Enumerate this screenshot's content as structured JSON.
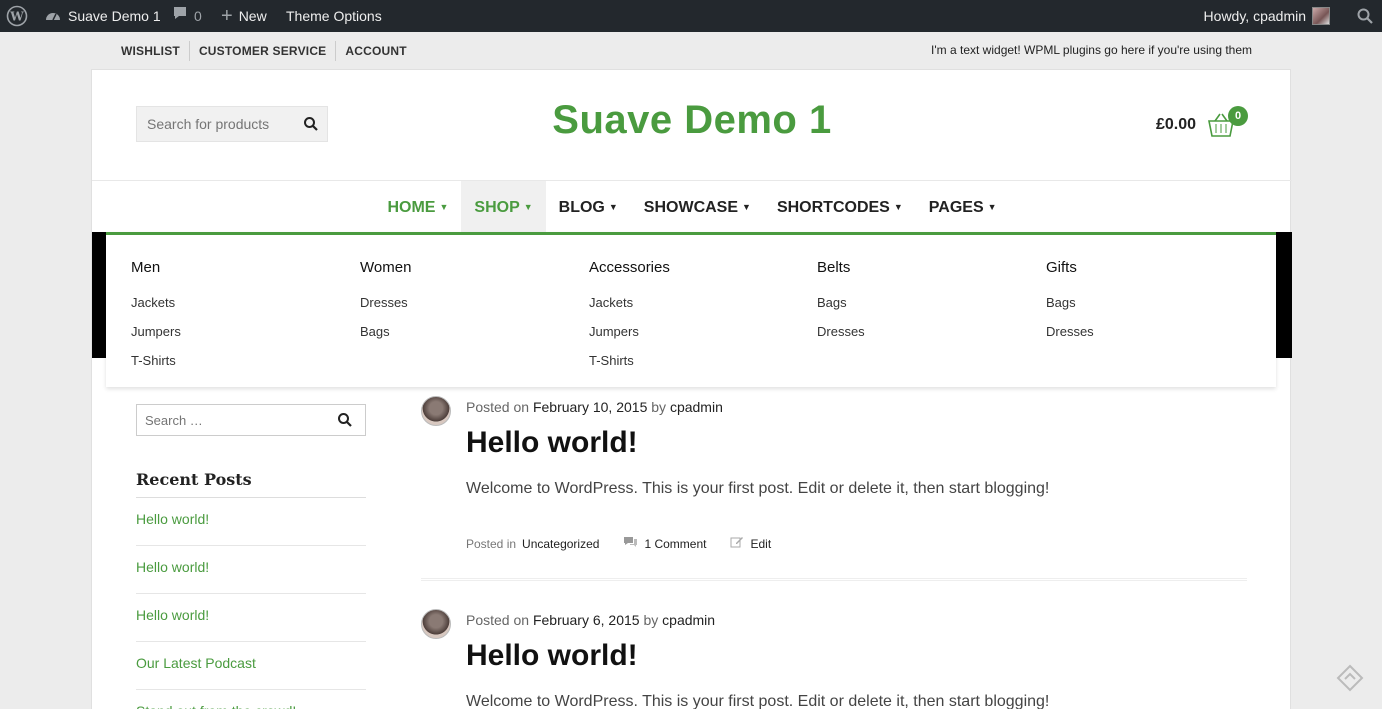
{
  "adminbar": {
    "site_name": "Suave Demo 1",
    "comments_count": "0",
    "new_label": "New",
    "theme_options": "Theme Options",
    "howdy": "Howdy, cpadmin"
  },
  "topbar": {
    "links": [
      "WISHLIST",
      "CUSTOMER SERVICE",
      "ACCOUNT"
    ],
    "widget_text": "I'm a text widget! WPML plugins go here if you're using them"
  },
  "header": {
    "search_placeholder": "Search for products",
    "site_title": "Suave Demo 1",
    "cart_total": "£0.00",
    "cart_count": "0"
  },
  "nav": {
    "items": [
      "HOME",
      "SHOP",
      "BLOG",
      "SHOWCASE",
      "SHORTCODES",
      "PAGES"
    ]
  },
  "mega_menu": {
    "columns": [
      {
        "title": "Men",
        "links": [
          "Jackets",
          "Jumpers",
          "T-Shirts"
        ]
      },
      {
        "title": "Women",
        "links": [
          "Dresses",
          "Bags"
        ]
      },
      {
        "title": "Accessories",
        "links": [
          "Jackets",
          "Jumpers",
          "T-Shirts"
        ]
      },
      {
        "title": "Belts",
        "links": [
          "Bags",
          "Dresses"
        ]
      },
      {
        "title": "Gifts",
        "links": [
          "Bags",
          "Dresses"
        ]
      }
    ]
  },
  "sidebar": {
    "search_placeholder": "Search …",
    "recent_title": "Recent Posts",
    "recent_posts": [
      "Hello world!",
      "Hello world!",
      "Hello world!",
      "Our Latest Podcast",
      "Stand out from the crowd!"
    ]
  },
  "posts": [
    {
      "posted_on": "Posted on",
      "date": "February 10, 2015",
      "by": "by",
      "author": "cpadmin",
      "title": "Hello world!",
      "excerpt": "Welcome to WordPress. This is your first post. Edit or delete it, then start blogging!",
      "posted_in": "Posted in",
      "category": "Uncategorized",
      "comments": "1 Comment",
      "edit": "Edit"
    },
    {
      "posted_on": "Posted on",
      "date": "February 6, 2015",
      "by": "by",
      "author": "cpadmin",
      "title": "Hello world!",
      "excerpt": "Welcome to WordPress. This is your first post. Edit or delete it, then start blogging!"
    }
  ],
  "colors": {
    "accent": "#4a9b3f",
    "adminbar": "#23282d",
    "text": "#222222"
  }
}
